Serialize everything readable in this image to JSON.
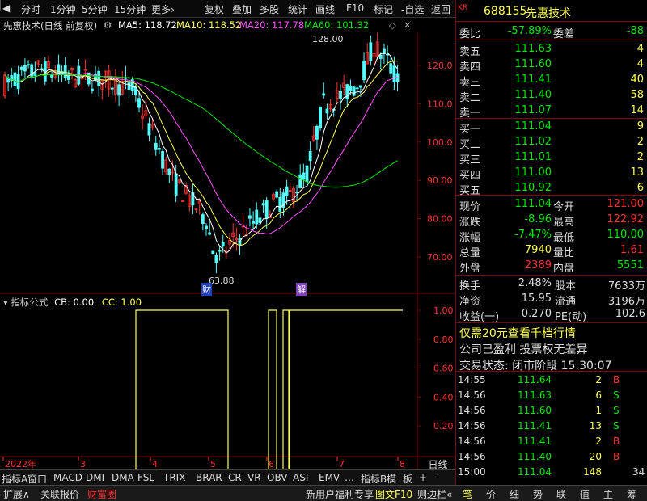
{
  "toolbar": {
    "items": [
      "分时",
      "1分钟",
      "5分钟",
      "15分钟",
      "更多›",
      "复权",
      "叠加",
      "多股",
      "统计",
      "画线",
      "F10",
      "标记",
      "-自选",
      "返回"
    ]
  },
  "info": {
    "stock_title": "先惠技术(日线 前复权)",
    "ma5": "MA5: 118.72",
    "ma10": "MA10: 118.52",
    "ma20": "MA20: 117.78",
    "ma60": "MA60: 101.32"
  },
  "chart": {
    "y_ticks": [
      "120.0",
      "110.0",
      "100.0",
      "90.00",
      "80.00",
      "70.00"
    ],
    "high_label": "128.00",
    "low_label": "63.88",
    "marker_cai": "财",
    "marker_jie": "解",
    "x_labels": [
      "2022年",
      "3",
      "4",
      "5",
      "6",
      "7",
      "8"
    ],
    "colors": {
      "up": "#ff3232",
      "down": "#54ffff",
      "ma5": "#ffffff",
      "ma10": "#ffff54",
      "ma20": "#ff54ff",
      "ma60": "#00e600",
      "grid": "#800000"
    }
  },
  "indicator": {
    "title": "指标公式",
    "cb": "CB: 0.00",
    "cc": "CC: 1.00",
    "y_ticks": [
      "1.00",
      "0.80",
      "0.60",
      "0.40",
      "0.20"
    ],
    "tab_label": "日线"
  },
  "quote": {
    "code": "688155",
    "name": "先惠技术",
    "weibi_label": "委比",
    "weibi": "-57.89%",
    "weicha_label": "委差",
    "weicha": "-88",
    "asks": [
      {
        "label": "卖五",
        "price": "111.63",
        "vol": "4"
      },
      {
        "label": "卖四",
        "price": "111.60",
        "vol": "4"
      },
      {
        "label": "卖三",
        "price": "111.41",
        "vol": "40"
      },
      {
        "label": "卖二",
        "price": "111.40",
        "vol": "58"
      },
      {
        "label": "卖一",
        "price": "111.07",
        "vol": "14"
      }
    ],
    "bids": [
      {
        "label": "买一",
        "price": "111.04",
        "vol": "9"
      },
      {
        "label": "买二",
        "price": "111.02",
        "vol": "2"
      },
      {
        "label": "买三",
        "price": "111.01",
        "vol": "2"
      },
      {
        "label": "买四",
        "price": "111.00",
        "vol": "13"
      },
      {
        "label": "买五",
        "price": "110.92",
        "vol": "6"
      }
    ],
    "stats": [
      {
        "l1": "现价",
        "v1": "111.04",
        "l2": "今开",
        "v2": "121.00"
      },
      {
        "l1": "涨跌",
        "v1": "-8.96",
        "l2": "最高",
        "v2": "122.92"
      },
      {
        "l1": "涨幅",
        "v1": "-7.47%",
        "l2": "最低",
        "v2": "110.00"
      },
      {
        "l1": "总量",
        "v1": "7940",
        "l2": "量比",
        "v2": "1.61"
      },
      {
        "l1": "外盘",
        "v1": "2389",
        "l2": "内盘",
        "v2": "5551"
      }
    ],
    "stats2": [
      {
        "l1": "换手",
        "v1": "2.48%",
        "l2": "股本",
        "v2": "7633万"
      },
      {
        "l1": "净资",
        "v1": "15.95",
        "l2": "流通",
        "v2": "3196万"
      },
      {
        "l1": "收益(一)",
        "v1": "0.270",
        "l2": "PE(动)",
        "v2": "102.6"
      }
    ],
    "promo": "仅需20元查看千档行情",
    "notice": "公司已盈利 投票权无差异",
    "status": "交易状态: 闭市阶段 15:30:07",
    "ticks": [
      {
        "t": "14:55",
        "p": "111.64",
        "v": "2",
        "d": "B"
      },
      {
        "t": "14:56",
        "p": "111.63",
        "v": "6",
        "d": "S"
      },
      {
        "t": "14:56",
        "p": "111.60",
        "v": "1",
        "d": "S"
      },
      {
        "t": "14:56",
        "p": "111.41",
        "v": "13",
        "d": "S"
      },
      {
        "t": "14:56",
        "p": "111.41",
        "v": "2",
        "d": "B"
      },
      {
        "t": "14:56",
        "p": "111.40",
        "v": "20",
        "d": "B"
      },
      {
        "t": "15:00",
        "p": "111.04",
        "v": "148",
        "d": "",
        "n": "34"
      }
    ]
  },
  "indicator_tabs": [
    "指标A",
    "窗口",
    "MACD",
    "DMI",
    "DMA",
    "FSL",
    "TRIX",
    "BRAR",
    "CR",
    "VR",
    "OBV",
    "ASI",
    "EMV",
    "…",
    "指标B",
    "模",
    "板",
    "+",
    "-"
  ],
  "bottom_bar": {
    "left": [
      "扩展∧",
      "关联报价",
      "财富圈"
    ],
    "mid": [
      "新用户福利专享",
      "图文F10",
      "则边栏«"
    ],
    "right": [
      "笔",
      "价",
      "细",
      "势",
      "联",
      "值",
      "主",
      "筹"
    ]
  }
}
